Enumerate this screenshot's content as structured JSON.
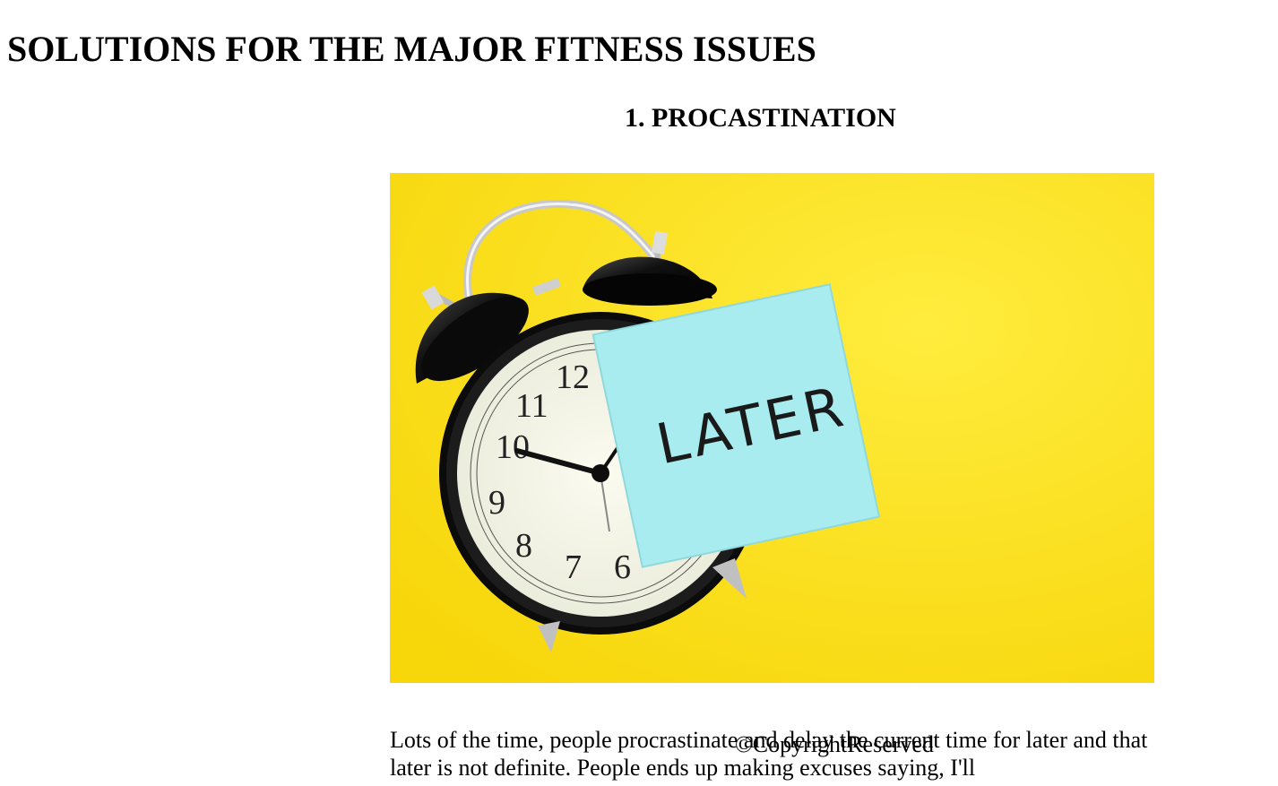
{
  "page": {
    "title": "SOLUTIONS FOR THE MAJOR FITNESS ISSUES",
    "background": "#ffffff"
  },
  "section": {
    "heading": "1. PROCASTINATION",
    "image": {
      "icon": "alarm-clock-with-sticky-note",
      "background_color": "#f9dc16",
      "note_color": "#a8ecef",
      "note_text": "LATER",
      "clock_numerals": [
        "12",
        "11",
        "10",
        "9",
        "8",
        "7",
        "6"
      ]
    },
    "paragraph": "Lots of the time, people procrastinate and delay the current time for later and that later is not definite. People ends up making excuses saying, I'll"
  },
  "footer": {
    "copyright": "©CopyrightReserved"
  }
}
